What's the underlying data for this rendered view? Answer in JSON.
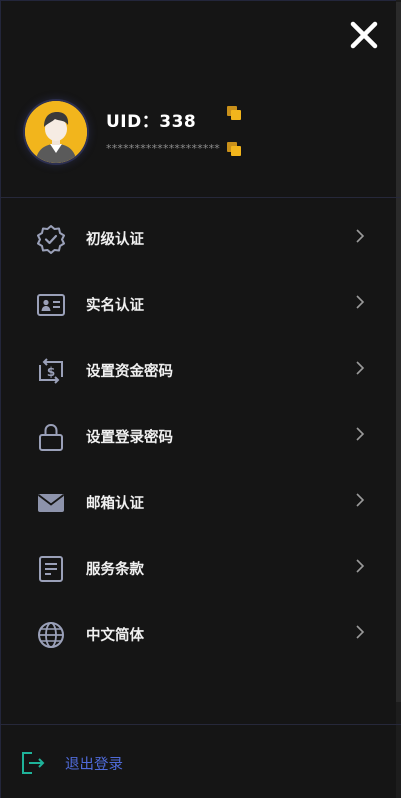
{
  "profile": {
    "uid_label": "UID：338",
    "token_masked": "********************"
  },
  "menu": {
    "items": [
      {
        "label": "初级认证",
        "icon": "badge-check-icon"
      },
      {
        "label": "实名认证",
        "icon": "id-card-icon"
      },
      {
        "label": "设置资金密码",
        "icon": "dollar-exchange-icon"
      },
      {
        "label": "设置登录密码",
        "icon": "lock-icon"
      },
      {
        "label": "邮箱认证",
        "icon": "envelope-icon"
      },
      {
        "label": "服务条款",
        "icon": "document-icon"
      },
      {
        "label": "中文简体",
        "icon": "globe-icon"
      }
    ]
  },
  "footer": {
    "logout_label": "退出登录"
  },
  "colors": {
    "background": "#151515",
    "accent_yellow": "#f2b51c",
    "logout_blue": "#4f6ad8",
    "icon_gray": "#9aa0b8",
    "logout_icon_teal": "#1fb39a"
  }
}
